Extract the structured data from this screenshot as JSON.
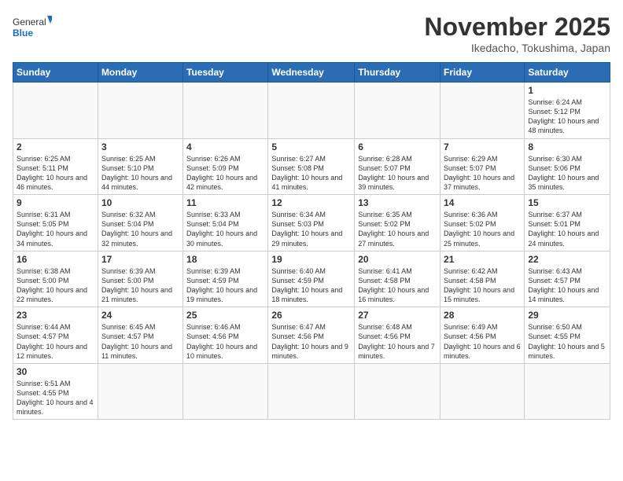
{
  "logo": {
    "text_general": "General",
    "text_blue": "Blue"
  },
  "header": {
    "month_year": "November 2025",
    "location": "Ikedacho, Tokushima, Japan"
  },
  "weekdays": [
    "Sunday",
    "Monday",
    "Tuesday",
    "Wednesday",
    "Thursday",
    "Friday",
    "Saturday"
  ],
  "weeks": [
    [
      {
        "num": "",
        "info": ""
      },
      {
        "num": "",
        "info": ""
      },
      {
        "num": "",
        "info": ""
      },
      {
        "num": "",
        "info": ""
      },
      {
        "num": "",
        "info": ""
      },
      {
        "num": "",
        "info": ""
      },
      {
        "num": "1",
        "info": "Sunrise: 6:24 AM\nSunset: 5:12 PM\nDaylight: 10 hours and 48 minutes."
      }
    ],
    [
      {
        "num": "2",
        "info": "Sunrise: 6:25 AM\nSunset: 5:11 PM\nDaylight: 10 hours and 46 minutes."
      },
      {
        "num": "3",
        "info": "Sunrise: 6:25 AM\nSunset: 5:10 PM\nDaylight: 10 hours and 44 minutes."
      },
      {
        "num": "4",
        "info": "Sunrise: 6:26 AM\nSunset: 5:09 PM\nDaylight: 10 hours and 42 minutes."
      },
      {
        "num": "5",
        "info": "Sunrise: 6:27 AM\nSunset: 5:08 PM\nDaylight: 10 hours and 41 minutes."
      },
      {
        "num": "6",
        "info": "Sunrise: 6:28 AM\nSunset: 5:07 PM\nDaylight: 10 hours and 39 minutes."
      },
      {
        "num": "7",
        "info": "Sunrise: 6:29 AM\nSunset: 5:07 PM\nDaylight: 10 hours and 37 minutes."
      },
      {
        "num": "8",
        "info": "Sunrise: 6:30 AM\nSunset: 5:06 PM\nDaylight: 10 hours and 35 minutes."
      }
    ],
    [
      {
        "num": "9",
        "info": "Sunrise: 6:31 AM\nSunset: 5:05 PM\nDaylight: 10 hours and 34 minutes."
      },
      {
        "num": "10",
        "info": "Sunrise: 6:32 AM\nSunset: 5:04 PM\nDaylight: 10 hours and 32 minutes."
      },
      {
        "num": "11",
        "info": "Sunrise: 6:33 AM\nSunset: 5:04 PM\nDaylight: 10 hours and 30 minutes."
      },
      {
        "num": "12",
        "info": "Sunrise: 6:34 AM\nSunset: 5:03 PM\nDaylight: 10 hours and 29 minutes."
      },
      {
        "num": "13",
        "info": "Sunrise: 6:35 AM\nSunset: 5:02 PM\nDaylight: 10 hours and 27 minutes."
      },
      {
        "num": "14",
        "info": "Sunrise: 6:36 AM\nSunset: 5:02 PM\nDaylight: 10 hours and 25 minutes."
      },
      {
        "num": "15",
        "info": "Sunrise: 6:37 AM\nSunset: 5:01 PM\nDaylight: 10 hours and 24 minutes."
      }
    ],
    [
      {
        "num": "16",
        "info": "Sunrise: 6:38 AM\nSunset: 5:00 PM\nDaylight: 10 hours and 22 minutes."
      },
      {
        "num": "17",
        "info": "Sunrise: 6:39 AM\nSunset: 5:00 PM\nDaylight: 10 hours and 21 minutes."
      },
      {
        "num": "18",
        "info": "Sunrise: 6:39 AM\nSunset: 4:59 PM\nDaylight: 10 hours and 19 minutes."
      },
      {
        "num": "19",
        "info": "Sunrise: 6:40 AM\nSunset: 4:59 PM\nDaylight: 10 hours and 18 minutes."
      },
      {
        "num": "20",
        "info": "Sunrise: 6:41 AM\nSunset: 4:58 PM\nDaylight: 10 hours and 16 minutes."
      },
      {
        "num": "21",
        "info": "Sunrise: 6:42 AM\nSunset: 4:58 PM\nDaylight: 10 hours and 15 minutes."
      },
      {
        "num": "22",
        "info": "Sunrise: 6:43 AM\nSunset: 4:57 PM\nDaylight: 10 hours and 14 minutes."
      }
    ],
    [
      {
        "num": "23",
        "info": "Sunrise: 6:44 AM\nSunset: 4:57 PM\nDaylight: 10 hours and 12 minutes."
      },
      {
        "num": "24",
        "info": "Sunrise: 6:45 AM\nSunset: 4:57 PM\nDaylight: 10 hours and 11 minutes."
      },
      {
        "num": "25",
        "info": "Sunrise: 6:46 AM\nSunset: 4:56 PM\nDaylight: 10 hours and 10 minutes."
      },
      {
        "num": "26",
        "info": "Sunrise: 6:47 AM\nSunset: 4:56 PM\nDaylight: 10 hours and 9 minutes."
      },
      {
        "num": "27",
        "info": "Sunrise: 6:48 AM\nSunset: 4:56 PM\nDaylight: 10 hours and 7 minutes."
      },
      {
        "num": "28",
        "info": "Sunrise: 6:49 AM\nSunset: 4:56 PM\nDaylight: 10 hours and 6 minutes."
      },
      {
        "num": "29",
        "info": "Sunrise: 6:50 AM\nSunset: 4:55 PM\nDaylight: 10 hours and 5 minutes."
      }
    ],
    [
      {
        "num": "30",
        "info": "Sunrise: 6:51 AM\nSunset: 4:55 PM\nDaylight: 10 hours and 4 minutes."
      },
      {
        "num": "",
        "info": ""
      },
      {
        "num": "",
        "info": ""
      },
      {
        "num": "",
        "info": ""
      },
      {
        "num": "",
        "info": ""
      },
      {
        "num": "",
        "info": ""
      },
      {
        "num": "",
        "info": ""
      }
    ]
  ]
}
